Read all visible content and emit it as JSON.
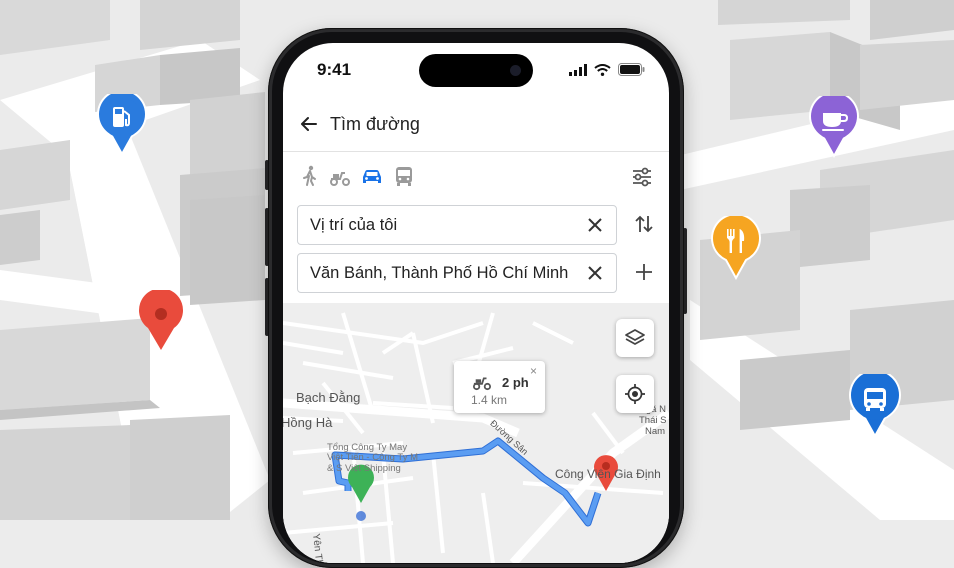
{
  "status_bar": {
    "time": "9:41"
  },
  "header": {
    "title": "Tìm đường"
  },
  "travel_modes": [
    "walk-icon",
    "scooter-icon",
    "car-icon",
    "bus-icon"
  ],
  "selected_mode": "car",
  "origin_field": {
    "value": "Vị trí của tôi"
  },
  "destination_field": {
    "value": "Văn Bánh, Thành Phố Hồ Chí Minh"
  },
  "route_callout": {
    "duration": "2 ph",
    "distance": "1.4 km",
    "close": "×"
  },
  "map_labels": {
    "bach_dang": "Bạch Đằng",
    "hong_ha": "Hồng Hà",
    "company_line1": "Tổng Công Ty May",
    "company_line2": "Việt Tiến - Công Ty M",
    "company_line3": "& S Việt Shipping",
    "park": "Công Viên Gia Định",
    "street_right1": "Ngã N",
    "street_right2": "Thái S",
    "street_right3": "Nam",
    "street_bottom": "Yên Thế",
    "street_route": "Đường Sân"
  },
  "background_pins": [
    "gas-station-icon",
    "location-pin-icon",
    "coffee-icon",
    "restaurant-icon",
    "bus-stop-icon"
  ],
  "colors": {
    "accent_blue": "#1a73e8",
    "route_blue": "#5b9df2",
    "gas_pin": "#2a7bde",
    "cafe_pin": "#8c63d6",
    "food_pin": "#f6a521",
    "bus_pin": "#1a6fd6",
    "dest_pin": "#e94b3c",
    "origin_pin": "#3db257"
  }
}
